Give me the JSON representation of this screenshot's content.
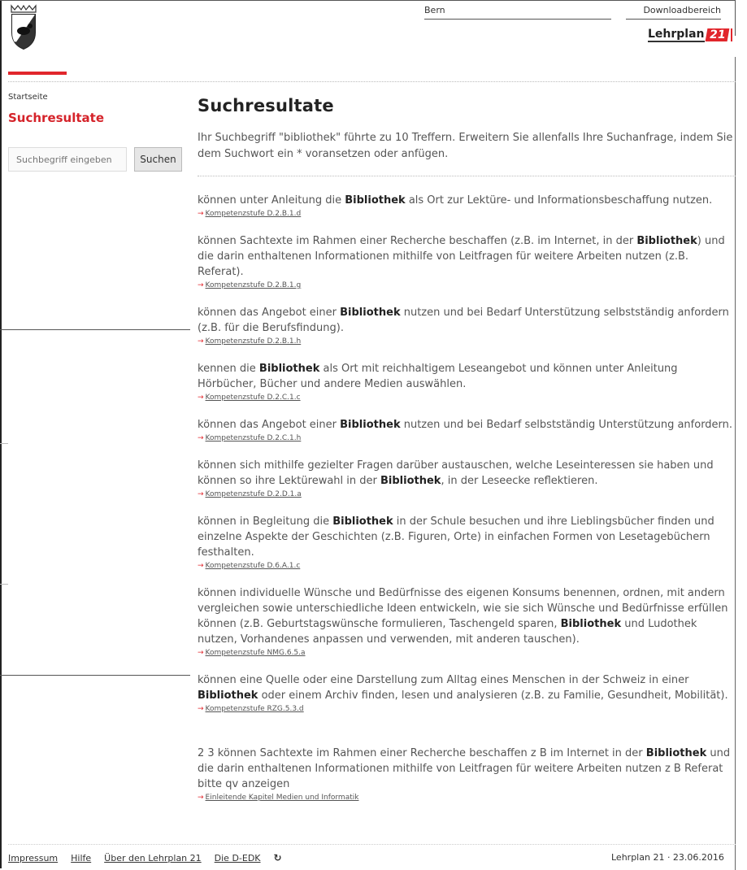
{
  "header": {
    "bern": "Bern",
    "download": "Downloadbereich",
    "logo_text": "Lehrplan",
    "logo_num": "21"
  },
  "sidebar": {
    "breadcrumb": "Startseite",
    "title": "Suchresultate",
    "search_placeholder": "Suchbegriff eingeben",
    "search_button": "Suchen"
  },
  "main": {
    "title": "Suchresultate",
    "intro": "Ihr Suchbegriff \"bibliothek\" führte zu 10 Treffern. Erweitern Sie allenfalls Ihre Suchanfrage, indem Sie dem Suchwort ein * voransetzen oder anfügen.",
    "results": [
      {
        "pre": "können unter Anleitung die ",
        "hit": "Bibliothek",
        "post": " als Ort zur Lektüre- und Informationsbeschaffung nutzen.",
        "link": "Kompetenzstufe D.2.B.1.d"
      },
      {
        "pre": "können Sachtexte im Rahmen einer Recherche beschaffen (z.B. im Internet, in der ",
        "hit": "Bibliothek",
        "post": ") und die darin enthaltenen Informationen mithilfe von Leitfragen für weitere Arbeiten nutzen (z.B. Referat).",
        "link": "Kompetenzstufe D.2.B.1.g"
      },
      {
        "pre": "können das Angebot einer ",
        "hit": "Bibliothek",
        "post": " nutzen und bei Bedarf Unterstützung selbstständig anfordern (z.B. für die Berufsfindung).",
        "link": "Kompetenzstufe D.2.B.1.h"
      },
      {
        "pre": "kennen die ",
        "hit": "Bibliothek",
        "post": " als Ort mit reichhaltigem Leseangebot und können unter Anleitung Hörbücher, Bücher und andere Medien auswählen.",
        "link": "Kompetenzstufe D.2.C.1.c"
      },
      {
        "pre": "können das Angebot einer ",
        "hit": "Bibliothek",
        "post": " nutzen und bei Bedarf selbstständig Unterstützung anfordern.",
        "link": "Kompetenzstufe D.2.C.1.h"
      },
      {
        "pre": "können sich mithilfe gezielter Fragen darüber austauschen, welche Leseinteressen sie haben und können so ihre Lektürewahl in der ",
        "hit": "Bibliothek",
        "post": ", in der Leseecke reflektieren.",
        "link": "Kompetenzstufe D.2.D.1.a"
      },
      {
        "pre": "können in Begleitung die ",
        "hit": "Bibliothek",
        "post": " in der Schule besuchen und ihre Lieblingsbücher finden und einzelne Aspekte der Geschichten (z.B. Figuren, Orte) in einfachen Formen von Lesetagebüchern festhalten.",
        "link": "Kompetenzstufe D.6.A.1.c"
      },
      {
        "pre": "können individuelle Wünsche und Bedürfnisse des eigenen Konsums benennen, ordnen, mit andern vergleichen sowie unterschiedliche Ideen entwickeln, wie sie sich Wünsche und Bedürfnisse erfüllen können (z.B. Geburtstagswünsche formulieren, Taschengeld sparen, ",
        "hit": "Bibliothek",
        "post": " und Ludothek nutzen, Vorhandenes anpassen und verwenden, mit anderen tauschen).",
        "link": "Kompetenzstufe NMG.6.5.a"
      },
      {
        "pre": "können eine Quelle oder eine Darstellung zum Alltag eines Menschen in der Schweiz in einer ",
        "hit": "Bibliothek",
        "post": " oder einem Archiv finden, lesen und analysieren (z.B. zu Familie, Gesundheit, Mobilität).",
        "link": "Kompetenzstufe RZG.5.3.d"
      },
      {
        "pre": "2 3 können Sachtexte im Rahmen einer Recherche beschaffen z B im Internet in der ",
        "hit": "Bibliothek",
        "post": " und die darin enthaltenen Informationen mithilfe von Leitfragen für weitere Arbeiten nutzen z B Referat bitte qv anzeigen",
        "link": "Einleitende Kapitel Medien und Informatik"
      }
    ]
  },
  "footer": {
    "links": [
      "Impressum",
      "Hilfe",
      "Über den Lehrplan 21",
      "Die D-EDK"
    ],
    "right": "Lehrplan 21 · 23.06.2016"
  },
  "colors": {
    "accent": "#e1262c",
    "title_red": "#d5232a"
  }
}
